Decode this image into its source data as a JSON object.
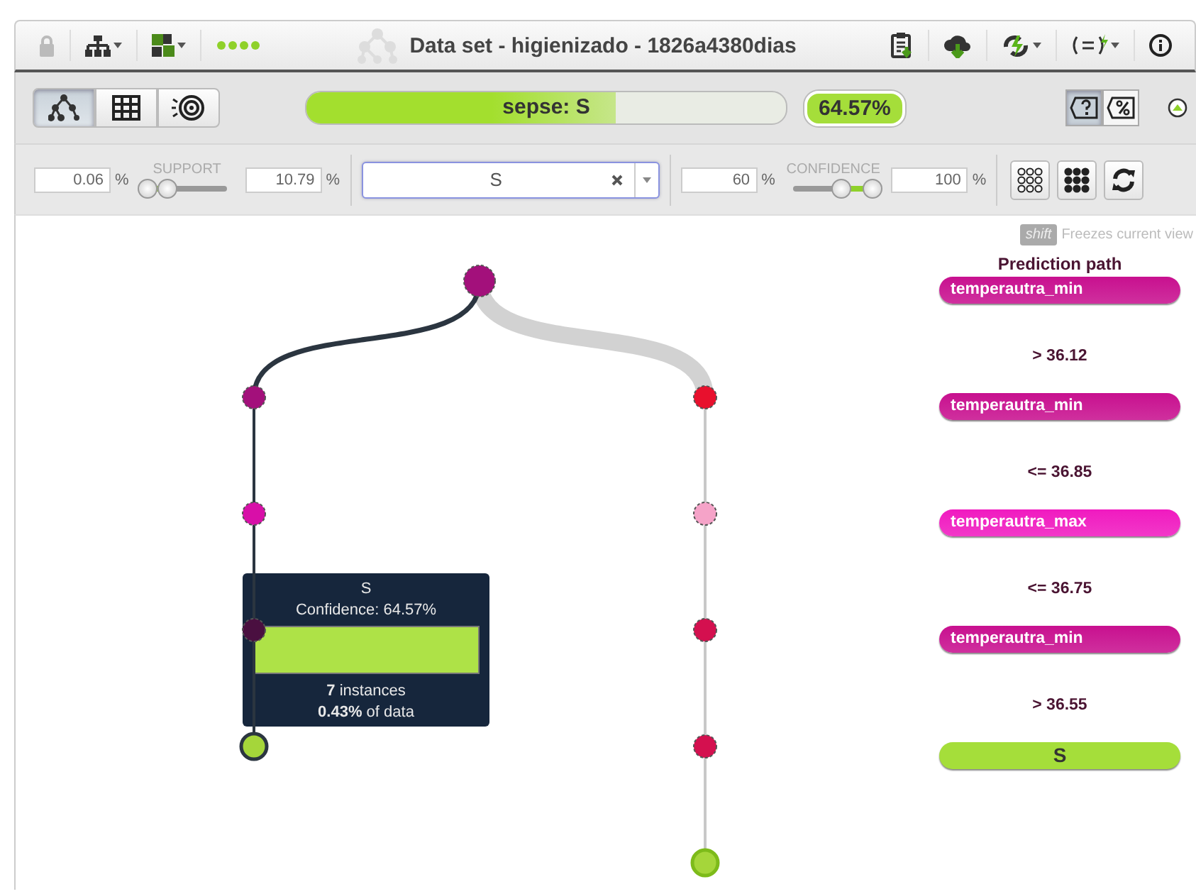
{
  "window": {
    "title": "Data set - higienizado - 1826a4380dias"
  },
  "views": [
    {
      "kind": "tree",
      "selected": true
    },
    {
      "kind": "grid",
      "selected": false
    },
    {
      "kind": "sunburst",
      "selected": false
    }
  ],
  "objective": {
    "label": "sepse: S",
    "level": 0.6457,
    "badge": "64.57%"
  },
  "display_modes": [
    {
      "kind": "question",
      "selected": true
    },
    {
      "kind": "percent",
      "selected": false
    }
  ],
  "support": {
    "label": "SUPPORT",
    "min": {
      "value": "0.06",
      "unit": "%"
    },
    "max": {
      "value": "10.79",
      "unit": "%"
    },
    "thumbs": [
      {
        "level": 0.0
      },
      {
        "level": 0.26
      }
    ]
  },
  "search": {
    "value": "S"
  },
  "confidence": {
    "label": "CONFIDENCE",
    "min": {
      "value": "60",
      "unit": "%"
    },
    "max": {
      "value": "100",
      "unit": "%"
    },
    "thumbs": [
      {
        "level": 0.6
      },
      {
        "level": 1.0
      }
    ]
  },
  "hint": {
    "key": "shift",
    "text": "Freezes current view"
  },
  "tree": {
    "color": "#a3107b",
    "children": [
      {
        "color": "#a3107b",
        "on_path": true,
        "children": [
          {
            "color": "#d80fa8",
            "on_path": true,
            "children": [
              {
                "color": "#4a0f40",
                "on_path": true,
                "children": [
                  {
                    "color": "#a5d63a",
                    "on_path": true
                  }
                ]
              }
            ]
          }
        ]
      },
      {
        "color": "#e8102d",
        "on_path": false,
        "children": [
          {
            "color": "#f5a3c8",
            "on_path": false,
            "children": [
              {
                "color": "#d4104f",
                "on_path": false,
                "children": [
                  {
                    "color": "#d4104f",
                    "on_path": false,
                    "children": [
                      {
                        "color": "#a5d63a",
                        "on_path": false
                      }
                    ]
                  }
                ]
              }
            ]
          }
        ]
      }
    ]
  },
  "tooltip": {
    "title": "S",
    "confidence": "Confidence: 64.57%",
    "level": 1.0,
    "instances": "**7** instances",
    "share": "**0.43%** of data"
  },
  "prediction_path": {
    "title": "Prediction path",
    "items": [
      {
        "kind": "field",
        "label": "temperautra_min",
        "color": "#c8108f"
      },
      {
        "kind": "condition",
        "label": "> 36.12"
      },
      {
        "kind": "field",
        "label": "temperautra_min",
        "color": "#c8108f"
      },
      {
        "kind": "condition",
        "label": "<= 36.85"
      },
      {
        "kind": "field",
        "label": "temperautra_max",
        "color": "#f01ac0"
      },
      {
        "kind": "condition",
        "label": "<= 36.75"
      },
      {
        "kind": "field",
        "label": "temperautra_min",
        "color": "#c8108f"
      },
      {
        "kind": "condition",
        "label": "> 36.55"
      },
      {
        "kind": "leaf",
        "label": "S",
        "color": "#a5de3a"
      }
    ]
  }
}
